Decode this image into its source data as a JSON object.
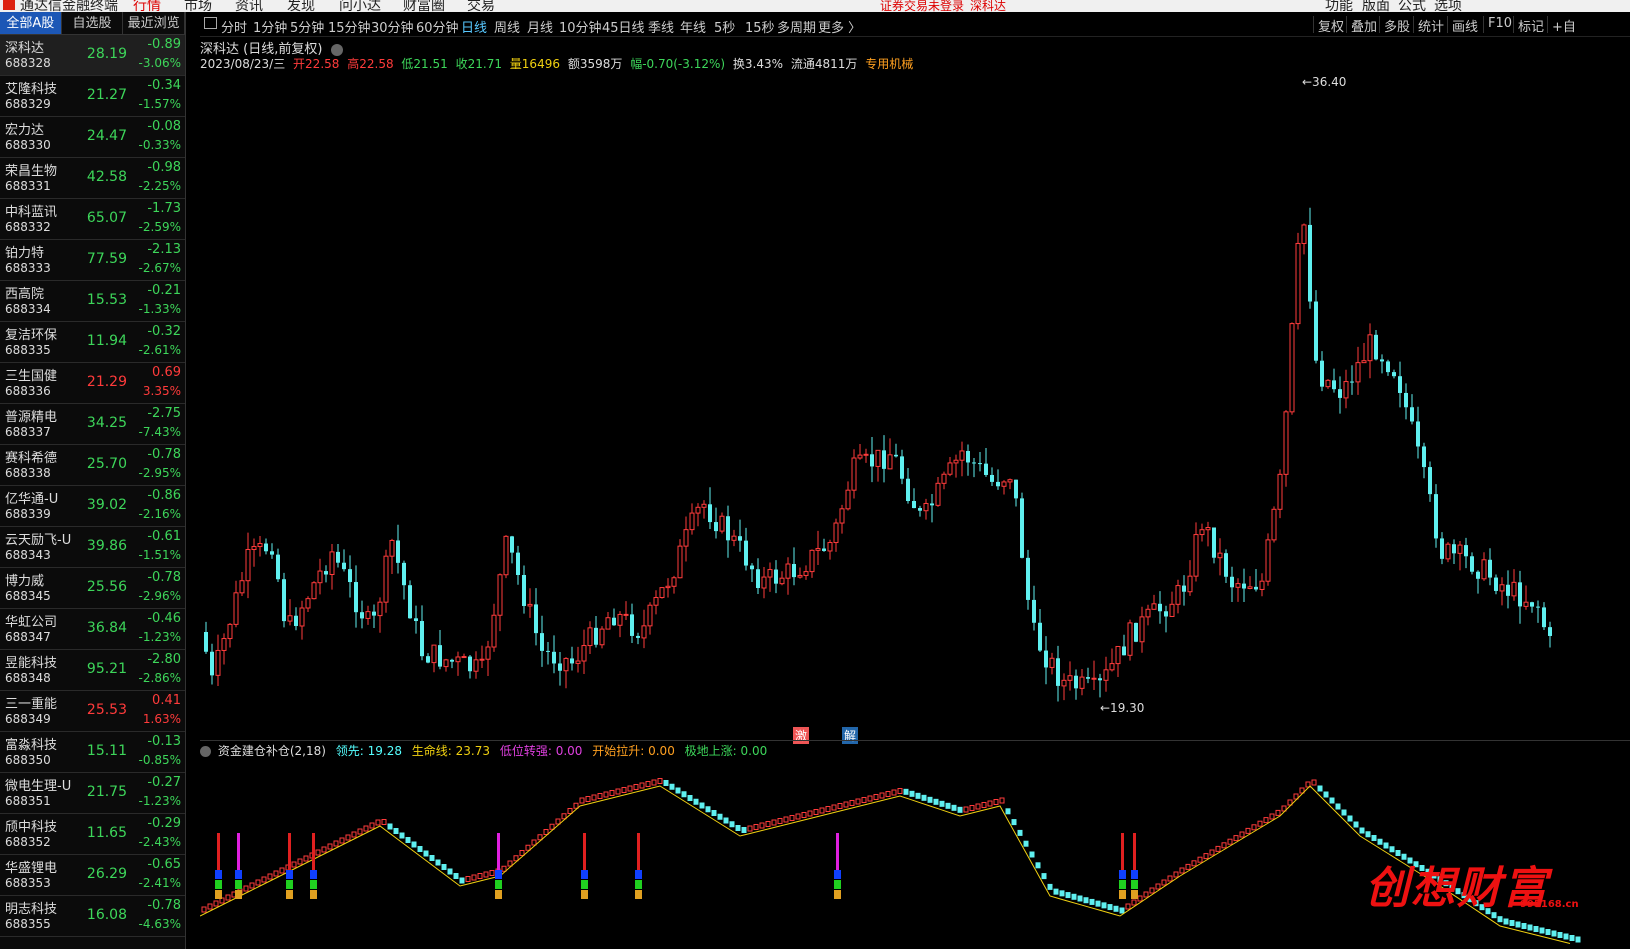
{
  "app": {
    "title": "通达信金融终端",
    "menu": [
      "行情",
      "市场",
      "资讯",
      "发现",
      "问小达",
      "财富圈",
      "交易"
    ],
    "notice": "证券交易未登录",
    "notice_stock": "深科达",
    "right_menu": [
      "功能",
      "版面",
      "公式",
      "选项"
    ]
  },
  "left_tabs": [
    "全部A股",
    "自选股",
    "最近浏览"
  ],
  "stocks": [
    {
      "name": "深科达",
      "code": "688328",
      "price": "28.19",
      "chg": "-0.89",
      "pct": "-3.06%",
      "dir": "down"
    },
    {
      "name": "艾隆科技",
      "code": "688329",
      "price": "21.27",
      "chg": "-0.34",
      "pct": "-1.57%",
      "dir": "down"
    },
    {
      "name": "宏力达",
      "code": "688330",
      "price": "24.47",
      "chg": "-0.08",
      "pct": "-0.33%",
      "dir": "down"
    },
    {
      "name": "荣昌生物",
      "code": "688331",
      "price": "42.58",
      "chg": "-0.98",
      "pct": "-2.25%",
      "dir": "down"
    },
    {
      "name": "中科蓝讯",
      "code": "688332",
      "price": "65.07",
      "chg": "-1.73",
      "pct": "-2.59%",
      "dir": "down"
    },
    {
      "name": "铂力特",
      "code": "688333",
      "price": "77.59",
      "chg": "-2.13",
      "pct": "-2.67%",
      "dir": "down"
    },
    {
      "name": "西高院",
      "code": "688334",
      "price": "15.53",
      "chg": "-0.21",
      "pct": "-1.33%",
      "dir": "down"
    },
    {
      "name": "复洁环保",
      "code": "688335",
      "price": "11.94",
      "chg": "-0.32",
      "pct": "-2.61%",
      "dir": "down"
    },
    {
      "name": "三生国健",
      "code": "688336",
      "price": "21.29",
      "chg": "0.69",
      "pct": "3.35%",
      "dir": "up"
    },
    {
      "name": "普源精电",
      "code": "688337",
      "price": "34.25",
      "chg": "-2.75",
      "pct": "-7.43%",
      "dir": "down"
    },
    {
      "name": "赛科希德",
      "code": "688338",
      "price": "25.70",
      "chg": "-0.78",
      "pct": "-2.95%",
      "dir": "down"
    },
    {
      "name": "亿华通-U",
      "code": "688339",
      "price": "39.02",
      "chg": "-0.86",
      "pct": "-2.16%",
      "dir": "down"
    },
    {
      "name": "云天励飞-U",
      "code": "688343",
      "price": "39.86",
      "chg": "-0.61",
      "pct": "-1.51%",
      "dir": "down"
    },
    {
      "name": "博力威",
      "code": "688345",
      "price": "25.56",
      "chg": "-0.78",
      "pct": "-2.96%",
      "dir": "down"
    },
    {
      "name": "华虹公司",
      "code": "688347",
      "price": "36.84",
      "chg": "-0.46",
      "pct": "-1.23%",
      "dir": "down"
    },
    {
      "name": "昱能科技",
      "code": "688348",
      "price": "95.21",
      "chg": "-2.80",
      "pct": "-2.86%",
      "dir": "down"
    },
    {
      "name": "三一重能",
      "code": "688349",
      "price": "25.53",
      "chg": "0.41",
      "pct": "1.63%",
      "dir": "up"
    },
    {
      "name": "富淼科技",
      "code": "688350",
      "price": "15.11",
      "chg": "-0.13",
      "pct": "-0.85%",
      "dir": "down"
    },
    {
      "name": "微电生理-U",
      "code": "688351",
      "price": "21.75",
      "chg": "-0.27",
      "pct": "-1.23%",
      "dir": "down"
    },
    {
      "name": "颀中科技",
      "code": "688352",
      "price": "11.65",
      "chg": "-0.29",
      "pct": "-2.43%",
      "dir": "down"
    },
    {
      "name": "华盛锂电",
      "code": "688353",
      "price": "26.29",
      "chg": "-0.65",
      "pct": "-2.41%",
      "dir": "down"
    },
    {
      "name": "明志科技",
      "code": "688355",
      "price": "16.08",
      "chg": "-0.78",
      "pct": "-4.63%",
      "dir": "down"
    }
  ],
  "periods": [
    "分时",
    "1分钟",
    "5分钟",
    "15分钟",
    "30分钟",
    "60分钟",
    "日线",
    "周线",
    "月线",
    "10分钟",
    "45日线",
    "季线",
    "年线",
    "5秒",
    "15秒",
    "多周期",
    "更多 〉"
  ],
  "active_period": "日线",
  "right_tools": [
    "复权",
    "叠加",
    "多股",
    "统计",
    "画线",
    "F10",
    "标记",
    "+自"
  ],
  "chart": {
    "title": "深科达 (日线,前复权)",
    "date": "2023/08/23/三",
    "open_label": "开22.58",
    "high_label": "高22.58",
    "low_label": "低21.51",
    "close_label": "收21.71",
    "vol_label": "量16496",
    "amt_label": "额3598万",
    "range_label": "幅-0.70(-3.12%)",
    "turn_label": "换3.43%",
    "float_label": "流通4811万",
    "industry": "专用机械",
    "max_label": "36.40",
    "min_label": "19.30",
    "tag_a": "激",
    "tag_b": "解"
  },
  "indicator": {
    "name": "资金建仓补仓(2,18)",
    "lead": "领先: 19.28",
    "life": "生命线: 23.73",
    "low_turn": "低位转强: 0.00",
    "pull": "开始拉升: 0.00",
    "bottom": "极地上涨: 0.00"
  },
  "watermark": {
    "text": "创想财富",
    "url": "995168.cn"
  },
  "colors": {
    "up": "#ff3b3b",
    "down": "#5ff0f0",
    "active": "#1c57b6"
  }
}
